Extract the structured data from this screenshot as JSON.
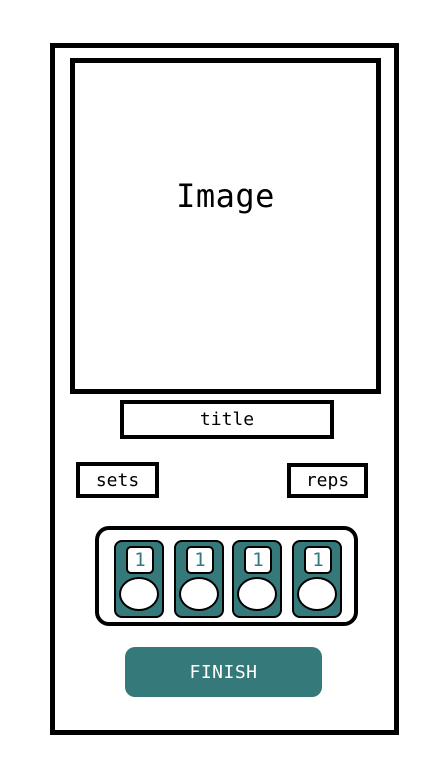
{
  "image_placeholder": "Image",
  "title_field": "title",
  "sets_field": "sets",
  "reps_field": "reps",
  "counters": [
    {
      "value": "1"
    },
    {
      "value": "1"
    },
    {
      "value": "1"
    },
    {
      "value": "1"
    }
  ],
  "finish_label": "FINISH",
  "colors": {
    "accent": "#36797a",
    "border": "#000000",
    "background": "#ffffff"
  }
}
